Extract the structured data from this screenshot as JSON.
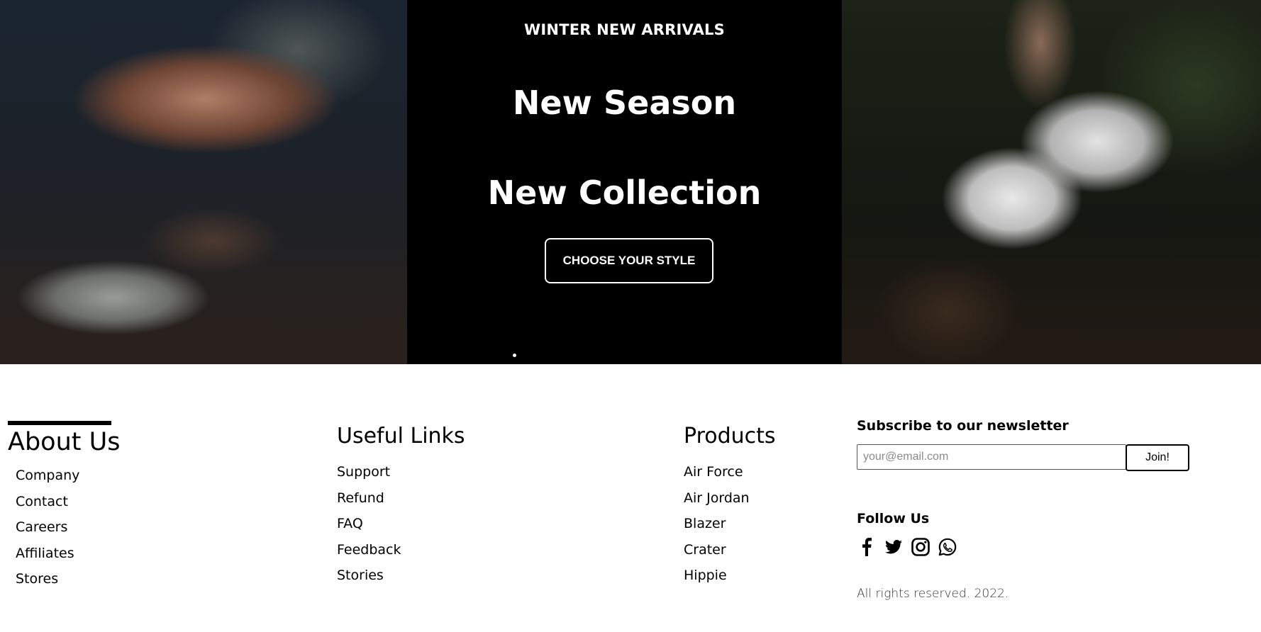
{
  "hero": {
    "eyebrow": "WINTER NEW ARRIVALS",
    "headline_line1": "New Season",
    "headline_line2": "New Collection",
    "cta_label": "CHOOSE YOUR STYLE"
  },
  "footer": {
    "about": {
      "title": "About Us",
      "items": [
        "Company",
        "Contact",
        "Careers",
        "Affiliates",
        "Stores"
      ]
    },
    "useful_links": {
      "title": "Useful Links",
      "items": [
        "Support",
        "Refund",
        "FAQ",
        "Feedback",
        "Stories"
      ]
    },
    "products": {
      "title": "Products",
      "items": [
        "Air Force",
        "Air Jordan",
        "Blazer",
        "Crater",
        "Hippie"
      ]
    },
    "newsletter": {
      "title": "Subscribe to our newsletter",
      "email_placeholder": "your@email.com",
      "email_value": "",
      "join_label": "Join!"
    },
    "follow": {
      "title": "Follow Us",
      "icons": [
        "facebook-icon",
        "twitter-icon",
        "instagram-icon",
        "whatsapp-icon"
      ]
    },
    "copyright": "All rights reserved. 2022."
  }
}
